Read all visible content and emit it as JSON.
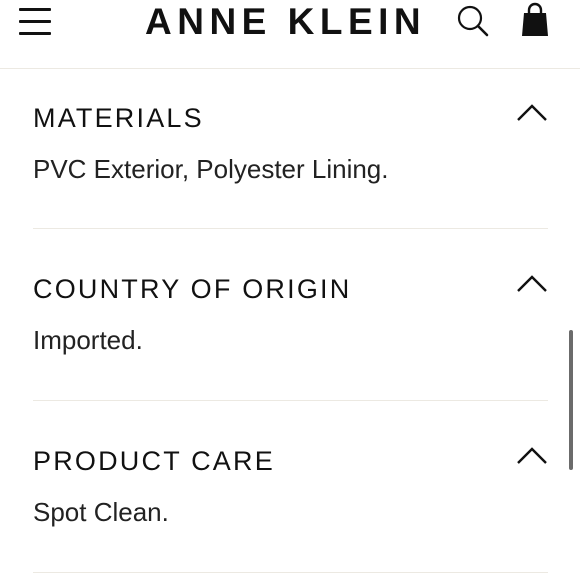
{
  "header": {
    "brand": "ANNE KLEIN",
    "menu_icon": "hamburger-menu-icon",
    "search_icon": "search-icon",
    "bag_icon": "shopping-bag-icon"
  },
  "sections": [
    {
      "title": "MATERIALS",
      "body": "PVC Exterior, Polyester Lining.",
      "expanded": true,
      "toggle_icon": "chevron-up-icon"
    },
    {
      "title": "COUNTRY OF ORIGIN",
      "body": "Imported.",
      "expanded": true,
      "toggle_icon": "chevron-up-icon"
    },
    {
      "title": "PRODUCT CARE",
      "body": "Spot Clean.",
      "expanded": true,
      "toggle_icon": "chevron-up-icon"
    }
  ],
  "colors": {
    "text": "#111111",
    "divider": "#ece9e2",
    "background": "#ffffff"
  }
}
